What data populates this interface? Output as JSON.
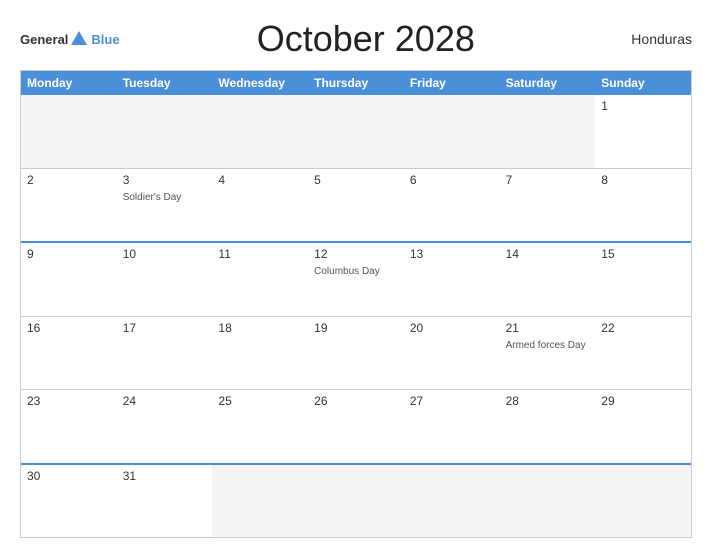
{
  "header": {
    "logo_general": "General",
    "logo_blue": "Blue",
    "title": "October 2028",
    "country": "Honduras"
  },
  "calendar": {
    "days_of_week": [
      "Monday",
      "Tuesday",
      "Wednesday",
      "Thursday",
      "Friday",
      "Saturday",
      "Sunday"
    ],
    "rows": [
      [
        {
          "num": "",
          "event": "",
          "empty": true
        },
        {
          "num": "",
          "event": "",
          "empty": true
        },
        {
          "num": "",
          "event": "",
          "empty": true
        },
        {
          "num": "",
          "event": "",
          "empty": true
        },
        {
          "num": "",
          "event": "",
          "empty": true
        },
        {
          "num": "",
          "event": "",
          "empty": true
        },
        {
          "num": "1",
          "event": "",
          "empty": false
        }
      ],
      [
        {
          "num": "2",
          "event": "",
          "empty": false
        },
        {
          "num": "3",
          "event": "Soldier's Day",
          "empty": false
        },
        {
          "num": "4",
          "event": "",
          "empty": false
        },
        {
          "num": "5",
          "event": "",
          "empty": false
        },
        {
          "num": "6",
          "event": "",
          "empty": false
        },
        {
          "num": "7",
          "event": "",
          "empty": false
        },
        {
          "num": "8",
          "event": "",
          "empty": false
        }
      ],
      [
        {
          "num": "9",
          "event": "",
          "empty": false
        },
        {
          "num": "10",
          "event": "",
          "empty": false
        },
        {
          "num": "11",
          "event": "",
          "empty": false
        },
        {
          "num": "12",
          "event": "Columbus Day",
          "empty": false
        },
        {
          "num": "13",
          "event": "",
          "empty": false
        },
        {
          "num": "14",
          "event": "",
          "empty": false
        },
        {
          "num": "15",
          "event": "",
          "empty": false
        }
      ],
      [
        {
          "num": "16",
          "event": "",
          "empty": false
        },
        {
          "num": "17",
          "event": "",
          "empty": false
        },
        {
          "num": "18",
          "event": "",
          "empty": false
        },
        {
          "num": "19",
          "event": "",
          "empty": false
        },
        {
          "num": "20",
          "event": "",
          "empty": false
        },
        {
          "num": "21",
          "event": "Armed forces Day",
          "empty": false
        },
        {
          "num": "22",
          "event": "",
          "empty": false
        }
      ],
      [
        {
          "num": "23",
          "event": "",
          "empty": false
        },
        {
          "num": "24",
          "event": "",
          "empty": false
        },
        {
          "num": "25",
          "event": "",
          "empty": false
        },
        {
          "num": "26",
          "event": "",
          "empty": false
        },
        {
          "num": "27",
          "event": "",
          "empty": false
        },
        {
          "num": "28",
          "event": "",
          "empty": false
        },
        {
          "num": "29",
          "event": "",
          "empty": false
        }
      ],
      [
        {
          "num": "30",
          "event": "",
          "empty": false
        },
        {
          "num": "31",
          "event": "",
          "empty": false
        },
        {
          "num": "",
          "event": "",
          "empty": true
        },
        {
          "num": "",
          "event": "",
          "empty": true
        },
        {
          "num": "",
          "event": "",
          "empty": true
        },
        {
          "num": "",
          "event": "",
          "empty": true
        },
        {
          "num": "",
          "event": "",
          "empty": true
        }
      ]
    ],
    "row_highlights": [
      2,
      5
    ]
  }
}
